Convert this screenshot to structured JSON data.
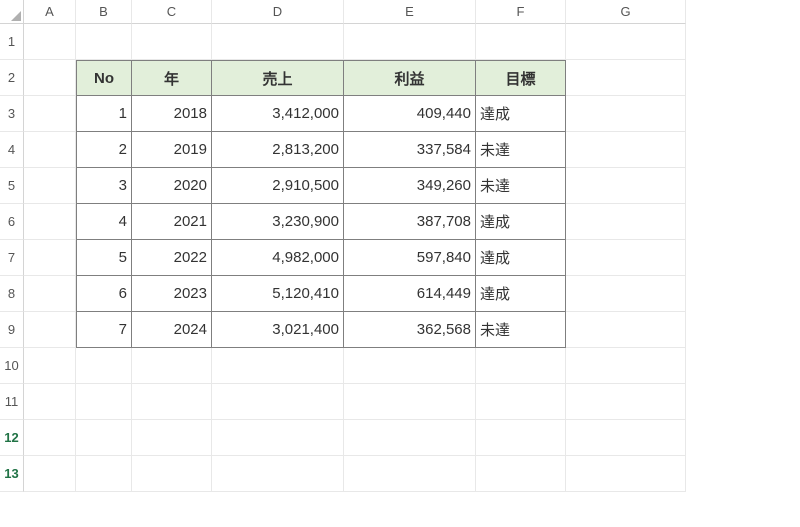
{
  "columns": [
    "",
    "A",
    "B",
    "C",
    "D",
    "E",
    "F",
    "G"
  ],
  "rowCount": 13,
  "selectedRows": [
    12,
    13
  ],
  "headers": {
    "no": "No",
    "year": "年",
    "sales": "売上",
    "profit": "利益",
    "target": "目標"
  },
  "rows": [
    {
      "no": "1",
      "year": "2018",
      "sales": "3,412,000",
      "profit": "409,440",
      "target": "達成"
    },
    {
      "no": "2",
      "year": "2019",
      "sales": "2,813,200",
      "profit": "337,584",
      "target": "未達"
    },
    {
      "no": "3",
      "year": "2020",
      "sales": "2,910,500",
      "profit": "349,260",
      "target": "未達"
    },
    {
      "no": "4",
      "year": "2021",
      "sales": "3,230,900",
      "profit": "387,708",
      "target": "達成"
    },
    {
      "no": "5",
      "year": "2022",
      "sales": "4,982,000",
      "profit": "597,840",
      "target": "達成"
    },
    {
      "no": "6",
      "year": "2023",
      "sales": "5,120,410",
      "profit": "614,449",
      "target": "達成"
    },
    {
      "no": "7",
      "year": "2024",
      "sales": "3,021,400",
      "profit": "362,568",
      "target": "未達"
    }
  ]
}
